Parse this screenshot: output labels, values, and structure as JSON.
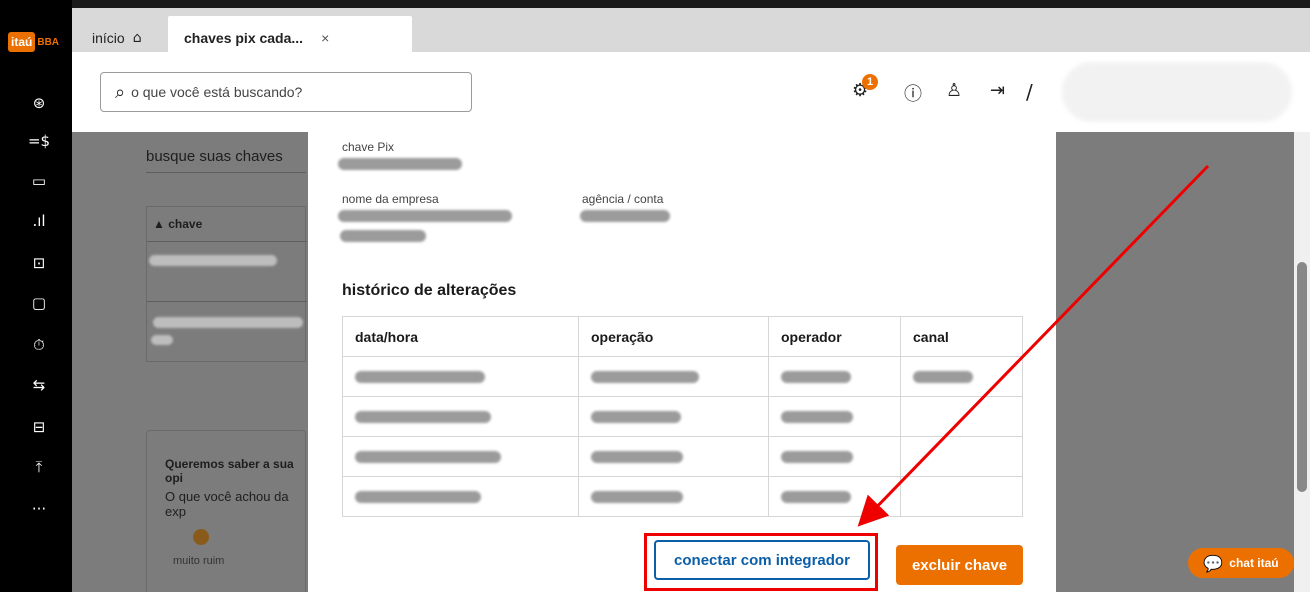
{
  "brand": {
    "logo_itau": "itaú",
    "logo_bba": "BBA",
    "accent": "#ec7000"
  },
  "sidebar": {
    "items": [
      {
        "glyph": "⊛",
        "name": "dollar-circle-icon"
      },
      {
        "glyph": "=$",
        "name": "transfer-icon"
      },
      {
        "glyph": "▭",
        "name": "wallet-icon"
      },
      {
        "glyph": ".ıl",
        "name": "chart-icon"
      },
      {
        "glyph": "⊡",
        "name": "payment-icon"
      },
      {
        "glyph": "▢",
        "name": "card-icon"
      },
      {
        "glyph": "⏱",
        "name": "safe-icon"
      },
      {
        "glyph": "⇆",
        "name": "exchange-icon"
      },
      {
        "glyph": "⊟",
        "name": "ticket-icon"
      },
      {
        "glyph": "⤒",
        "name": "upload-icon"
      },
      {
        "glyph": "···",
        "name": "more-icon"
      }
    ]
  },
  "tabs": {
    "inicio": "início",
    "active": "chaves pix cada...",
    "close": "×"
  },
  "header": {
    "search_placeholder": "o que você está buscando?",
    "badge_count": "1",
    "slash": "/"
  },
  "background": {
    "search_label": "busque suas chaves",
    "column": "▲ chave",
    "feedback_title": "Queremos saber a sua opi",
    "feedback_question": "O que você achou da exp",
    "rating_label": "muito ruim"
  },
  "modal": {
    "chave_pix_label": "chave Pix",
    "empresa_label": "nome da empresa",
    "agencia_label": "agência / conta",
    "history_title": "histórico de alterações",
    "columns": [
      "data/hora",
      "operação",
      "operador",
      "canal"
    ],
    "integrador_button": "conectar com integrador",
    "excluir_button": "excluir chave"
  },
  "chat": {
    "label": "chat itaú"
  }
}
